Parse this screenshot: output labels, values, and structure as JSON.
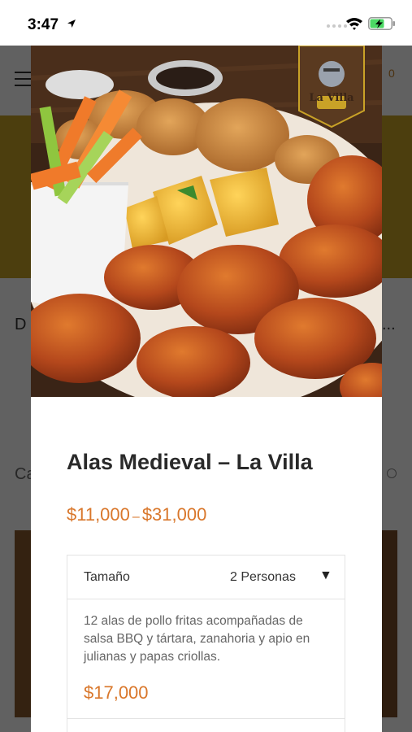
{
  "status_bar": {
    "time": "3:47"
  },
  "background": {
    "cart_count": "0",
    "partial_text_left": "D",
    "partial_text_right": "...",
    "partial_text_left2": "Ca"
  },
  "modal": {
    "logo_text": "La Villa",
    "product_title": "Alas Medieval – La Villa",
    "price_min": "$11,000",
    "price_separator": "–",
    "price_max": "$31,000",
    "option": {
      "label": "Tamaño",
      "selected_value": "2 Personas",
      "arrow": "▼"
    },
    "variation_description": "12 alas de pollo fritas acompañadas de salsa BBQ y tártara, zanahoria y apio en julianas y papas criollas.",
    "variation_price": "$17,000"
  },
  "colors": {
    "accent_price": "#d9772b",
    "banner": "#c9a227"
  }
}
